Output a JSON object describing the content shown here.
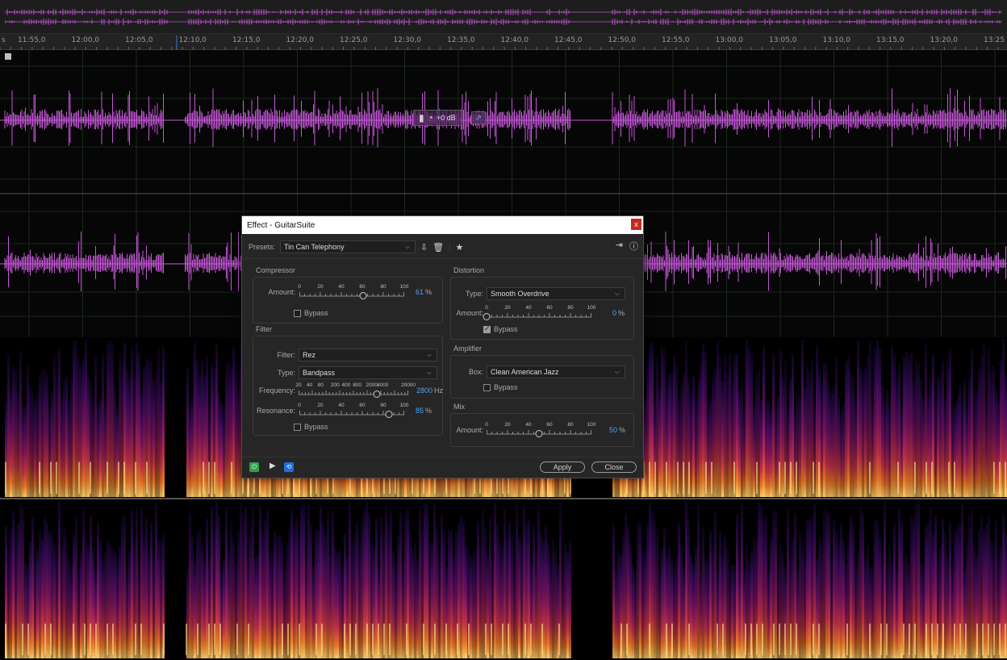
{
  "ruler": {
    "labels": [
      "11:55,0",
      "12:00,0",
      "12:05,0",
      "12:10,0",
      "12:15,0",
      "12:20,0",
      "12:25,0",
      "12:30,0",
      "12:35,0",
      "12:40,0",
      "12:45,0",
      "12:50,0",
      "12:55,0",
      "13:00,0",
      "13:05,0",
      "13:10,0",
      "13:15,0",
      "13:20,0",
      "13:25"
    ],
    "leading_unit": "s"
  },
  "hud": {
    "gain_label": "+0 dB"
  },
  "dialog": {
    "title": "Effect - GuitarSuite",
    "close_label": "x",
    "presets_label": "Presets:",
    "preset_value": "Tin Can Telephony",
    "compressor": {
      "title": "Compressor",
      "amount_label": "Amount:",
      "ticks": [
        "0",
        "20",
        "40",
        "60",
        "80",
        "100"
      ],
      "value": 61,
      "value_text": "61",
      "unit": "%",
      "bypass_label": "Bypass",
      "bypass_checked": false
    },
    "filter": {
      "title": "Filter",
      "filter_label": "Filter:",
      "filter_value": "Rez",
      "type_label": "Type:",
      "type_value": "Bandpass",
      "frequency_label": "Frequency:",
      "frequency_ticks": [
        "20",
        "40",
        "80",
        "200",
        "400",
        "800",
        "2000",
        "4000",
        "20000"
      ],
      "frequency_value": 2800,
      "frequency_text": "2800",
      "frequency_unit": "Hz",
      "resonance_label": "Resonance:",
      "resonance_ticks": [
        "0",
        "20",
        "40",
        "60",
        "80",
        "100"
      ],
      "resonance_value": 85,
      "resonance_text": "85",
      "resonance_unit": "%",
      "bypass_label": "Bypass",
      "bypass_checked": false
    },
    "distortion": {
      "title": "Distortion",
      "type_label": "Type:",
      "type_value": "Smooth Overdrive",
      "amount_label": "Amount:",
      "ticks": [
        "0",
        "20",
        "40",
        "60",
        "80",
        "100"
      ],
      "value": 0,
      "value_text": "0",
      "unit": "%",
      "bypass_label": "Bypass",
      "bypass_checked": true
    },
    "amplifier": {
      "title": "Amplifier",
      "box_label": "Box:",
      "box_value": "Clean American Jazz",
      "bypass_label": "Bypass",
      "bypass_checked": false
    },
    "mix": {
      "title": "Mix",
      "amount_label": "Amount:",
      "ticks": [
        "0",
        "20",
        "40",
        "60",
        "80",
        "100"
      ],
      "value": 50,
      "value_text": "50",
      "unit": "%"
    },
    "footer": {
      "apply_label": "Apply",
      "close_label": "Close"
    }
  },
  "colors": {
    "waveform": "#c557d8",
    "accent_blue": "#4aa3ff",
    "power_green": "#2ea34a"
  }
}
